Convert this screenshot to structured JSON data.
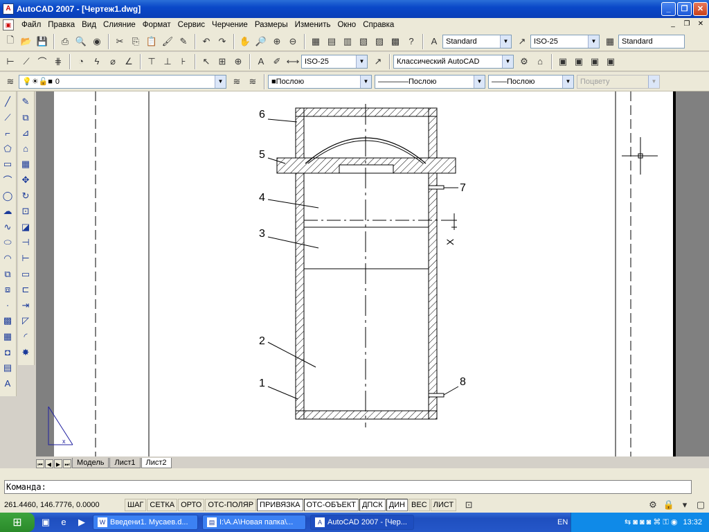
{
  "window": {
    "title": "AutoCAD 2007 - [Чертеж1.dwg]",
    "app_icon_label": "A"
  },
  "menu": {
    "items": [
      "Файл",
      "Правка",
      "Вид",
      "Слияние",
      "Формат",
      "Сервис",
      "Черчение",
      "Размеры",
      "Изменить",
      "Окно",
      "Справка"
    ]
  },
  "toolbars": {
    "text_style": "Standard",
    "dim_style": "ISO-25",
    "table_style": "Standard",
    "dim_style2": "ISO-25",
    "workspace": "Классический AutoCAD",
    "layer": "0",
    "color": "Послою",
    "linetype": "Послою",
    "lineweight": "Послою",
    "plotstyle": "Поцвету"
  },
  "drawing": {
    "callouts": [
      "6",
      "5",
      "4",
      "3",
      "2",
      "1",
      "7",
      "8"
    ],
    "dim_label": "X"
  },
  "layout_tabs": [
    "Модель",
    "Лист1",
    "Лист2"
  ],
  "active_tab": "Лист2",
  "command_line": "Команда:",
  "status": {
    "coords": "261.4460, 146.7776, 0.0000",
    "buttons": [
      "ШАГ",
      "СЕТКА",
      "ОРТО",
      "ОТС-ПОЛЯР",
      "ПРИВЯЗКА",
      "ОТС-ОБЪЕКТ",
      "ДПСК",
      "ДИН",
      "ВЕС",
      "ЛИСТ"
    ]
  },
  "taskbar": {
    "tasks": [
      "Введени1. Мусаев.d...",
      "I:\\A.A\\Новая папка\\...",
      "AutoCAD 2007 - [Чер..."
    ],
    "lang": "EN",
    "clock": "13:32"
  }
}
